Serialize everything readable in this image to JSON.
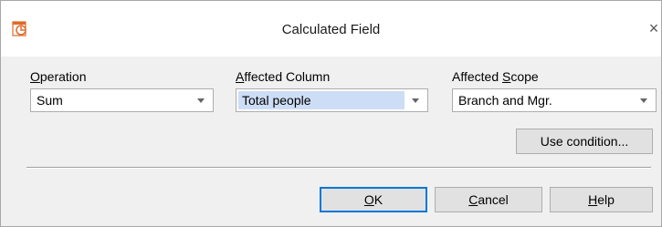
{
  "window": {
    "title": "Calculated Field"
  },
  "fields": {
    "operation": {
      "label_prefix": "",
      "label_key": "O",
      "label_rest": "peration",
      "value": "Sum"
    },
    "column": {
      "label_prefix": "",
      "label_key": "A",
      "label_rest": "ffected Column",
      "value": "Total people"
    },
    "scope": {
      "label_prefix": "Affected ",
      "label_key": "S",
      "label_rest": "cope",
      "value": "Branch and Mgr."
    }
  },
  "buttons": {
    "use_condition": "Use condition...",
    "ok_key": "O",
    "ok_rest": "K",
    "cancel_key": "C",
    "cancel_rest": "ancel",
    "help_key": "H",
    "help_rest": "elp"
  },
  "icons": {
    "app": "calculated-field-app-icon",
    "close": "close-icon",
    "dropdown": "chevron-down-icon"
  },
  "colors": {
    "selection": "#cdddf5",
    "default_button_border": "#0078d7",
    "icon_accent": "#e06a2a"
  }
}
